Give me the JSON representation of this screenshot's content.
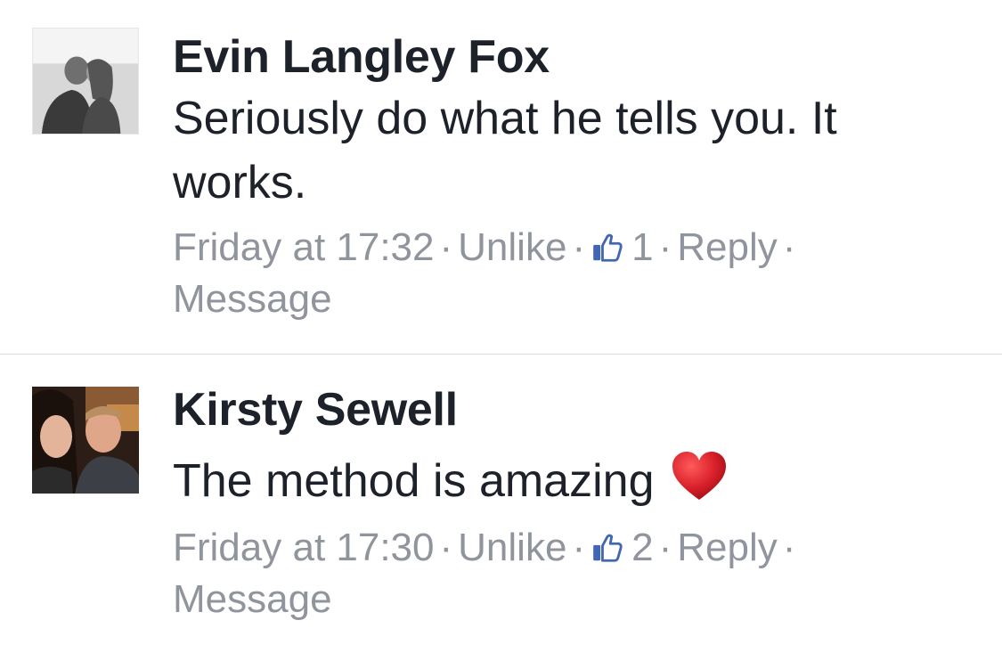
{
  "comments": [
    {
      "author": "Evin Langley Fox",
      "text": "Seriously do what he tells you. It works.",
      "time": "Friday at 17:32",
      "unlike": "Unlike",
      "likes": "1",
      "reply": "Reply",
      "message": "Message",
      "separator": "·",
      "avatar_icon": "couple-photo-bw"
    },
    {
      "author": "Kirsty Sewell",
      "text": "The method is amazing",
      "emoji_icon": "heart-icon",
      "time": "Friday at 17:30",
      "unlike": "Unlike",
      "likes": "2",
      "reply": "Reply",
      "message": "Message",
      "separator": "·",
      "avatar_icon": "couple-selfie-photo"
    }
  ],
  "colors": {
    "text": "#1d2129",
    "meta": "#90949c",
    "like_blue": "#4267b2",
    "heart": "#d9202a",
    "divider": "#dadde1"
  }
}
